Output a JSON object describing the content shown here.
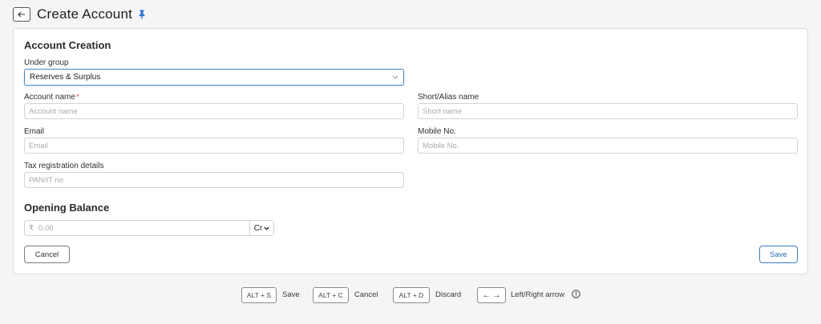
{
  "header": {
    "title": "Create Account"
  },
  "form": {
    "section_title": "Account Creation",
    "under_group": {
      "label": "Under group",
      "value": "Reserves & Surplus"
    },
    "account_name": {
      "label": "Account name",
      "required_mark": "*",
      "placeholder": "Account name"
    },
    "short_name": {
      "label": "Short/Alias name",
      "placeholder": "Short name"
    },
    "email": {
      "label": "Email",
      "placeholder": "Email"
    },
    "mobile": {
      "label": "Mobile No.",
      "placeholder": "Mobile No."
    },
    "tax": {
      "label": "Tax registration details",
      "placeholder": "PAN/IT no"
    },
    "opening_balance": {
      "title": "Opening Balance",
      "currency_symbol": "₹",
      "placeholder": "0.00",
      "type_value": "Cr"
    },
    "cancel_label": "Cancel",
    "save_label": "Save"
  },
  "shortcuts": [
    {
      "key": "ALT + S",
      "label": "Save"
    },
    {
      "key": "ALT + C",
      "label": "Cancel"
    },
    {
      "key": "ALT + D",
      "label": "Discard"
    },
    {
      "key": "← →",
      "label": "Left/Right arrow"
    }
  ],
  "colors": {
    "accent": "#3a7bc8",
    "required": "#e03131",
    "pin": "#2f6fd1"
  }
}
